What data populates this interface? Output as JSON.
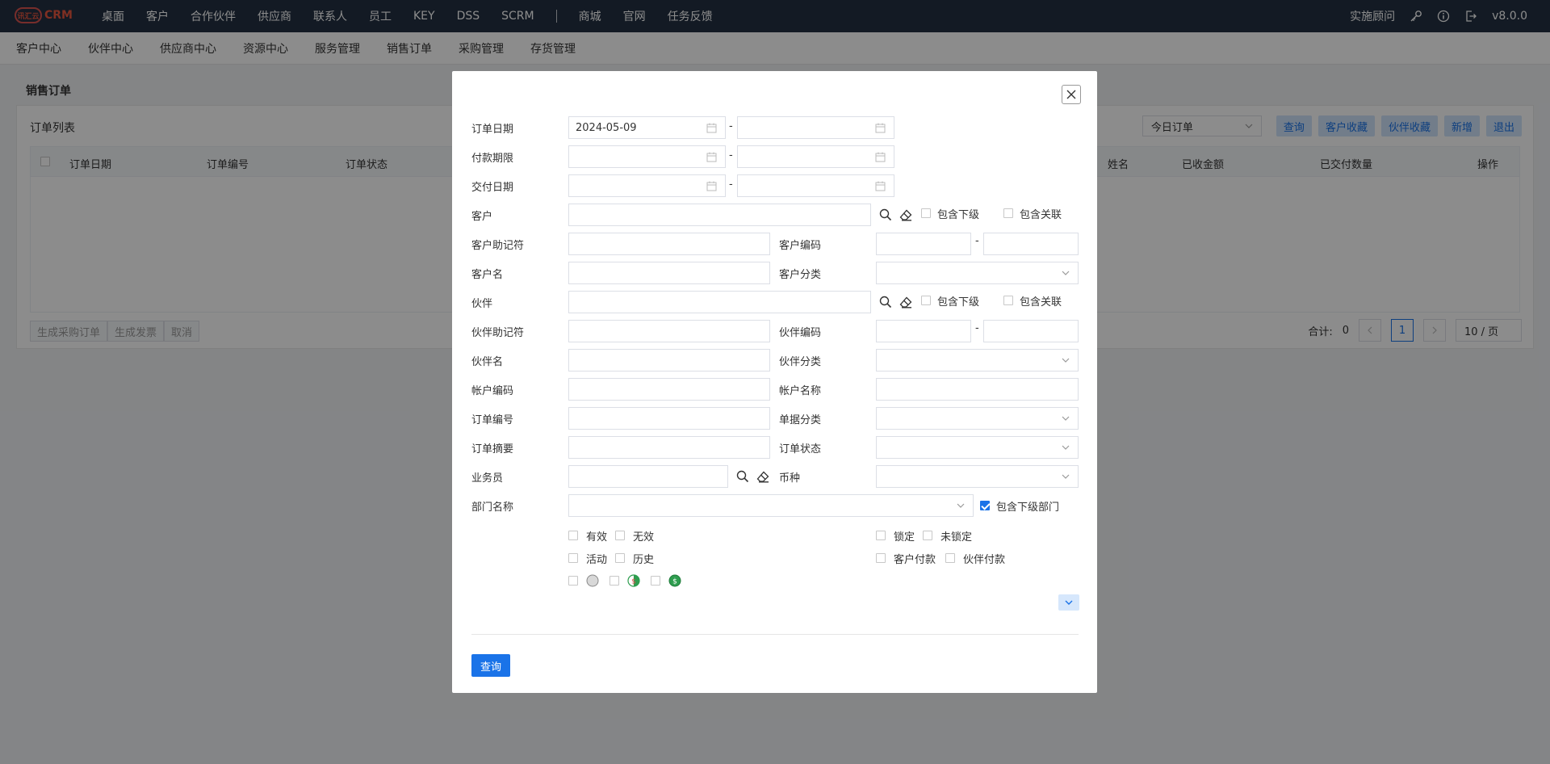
{
  "topbar": {
    "logo_badge": "讯汇云",
    "logo_text": "CRM",
    "nav": [
      "桌面",
      "客户",
      "合作伙伴",
      "供应商",
      "联系人",
      "员工",
      "KEY",
      "DSS",
      "SCRM"
    ],
    "nav_after_sep": [
      "商城",
      "官网",
      "任务反馈"
    ],
    "consultant": "实施顾问",
    "version": "v8.0.0"
  },
  "subnav": [
    "客户中心",
    "伙伴中心",
    "供应商中心",
    "资源中心",
    "服务管理",
    "销售订单",
    "采购管理",
    "存货管理"
  ],
  "page": {
    "title": "销售订单",
    "panel_title": "订单列表",
    "filter_select": "今日订单",
    "buttons": [
      "查询",
      "客户收藏",
      "伙伴收藏",
      "新增",
      "退出"
    ],
    "columns": {
      "order_date": "订单日期",
      "order_no": "订单编号",
      "order_status": "订单状态",
      "name_suffix": "姓名",
      "received_amount": "已收金额",
      "delivered_qty": "已交付数量",
      "actions": "操作"
    },
    "bottom_buttons": [
      "生成采购订单",
      "生成发票",
      "取消"
    ],
    "pager": {
      "total_label": "合计:",
      "total": "0",
      "current_page": "1",
      "page_size": "10 / 页"
    }
  },
  "modal": {
    "labels": {
      "order_date": "订单日期",
      "payment_term": "付款期限",
      "delivery_date": "交付日期",
      "customer": "客户",
      "customer_mnemonic": "客户助记符",
      "customer_code": "客户编码",
      "customer_name": "客户名",
      "customer_category": "客户分类",
      "partner": "伙伴",
      "partner_mnemonic": "伙伴助记符",
      "partner_code": "伙伴编码",
      "partner_name": "伙伴名",
      "partner_category": "伙伴分类",
      "account_code": "帐户编码",
      "account_name": "帐户名称",
      "order_no": "订单编号",
      "doc_category": "单据分类",
      "order_summary": "订单摘要",
      "order_status": "订单状态",
      "salesperson": "业务员",
      "currency": "币种",
      "department": "部门名称"
    },
    "values": {
      "order_date_from": "2024-05-09"
    },
    "dash": "-",
    "checkboxes": {
      "include_sub": "包含下级",
      "include_related": "包含关联",
      "include_sub_dept": "包含下级部门",
      "valid": "有效",
      "invalid": "无效",
      "locked": "锁定",
      "unlocked": "未锁定",
      "active": "活动",
      "history": "历史",
      "customer_pay": "客户付款",
      "partner_pay": "伙伴付款"
    },
    "query_button": "查询"
  },
  "colors": {
    "topbar": "#233142",
    "primary": "#1a73e8",
    "logo": "#e8563f"
  }
}
